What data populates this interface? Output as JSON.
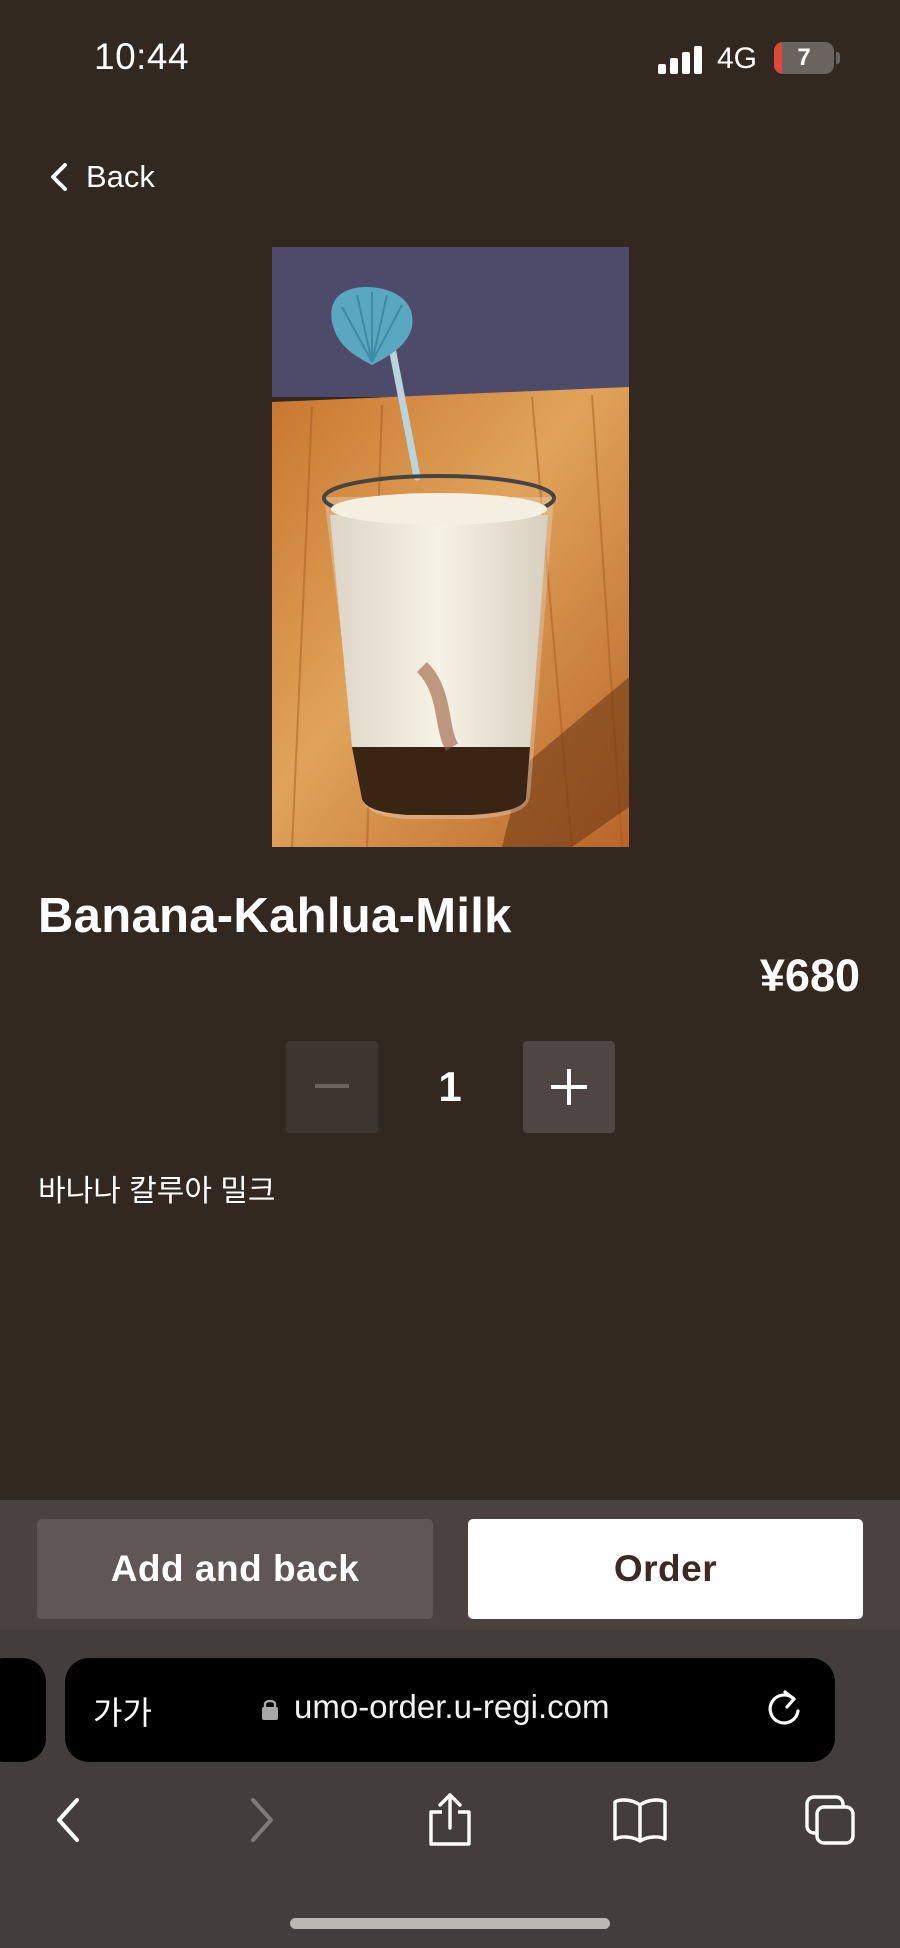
{
  "status_bar": {
    "time": "10:44",
    "network": "4G",
    "battery_level": "7"
  },
  "nav": {
    "back_label": "Back"
  },
  "product": {
    "name": "Banana-Kahlua-Milk",
    "price": "¥680",
    "quantity": "1",
    "description": "바나나 칼루아 밀크"
  },
  "actions": {
    "add_and_back_label": "Add and back",
    "order_label": "Order"
  },
  "browser": {
    "text_size_label": "가가",
    "url": "umo-order.u-regi.com"
  },
  "colors": {
    "background": "#322820",
    "order_button": "#ffffff",
    "add_button": "#5f5756",
    "battery_low": "#e0463a"
  }
}
